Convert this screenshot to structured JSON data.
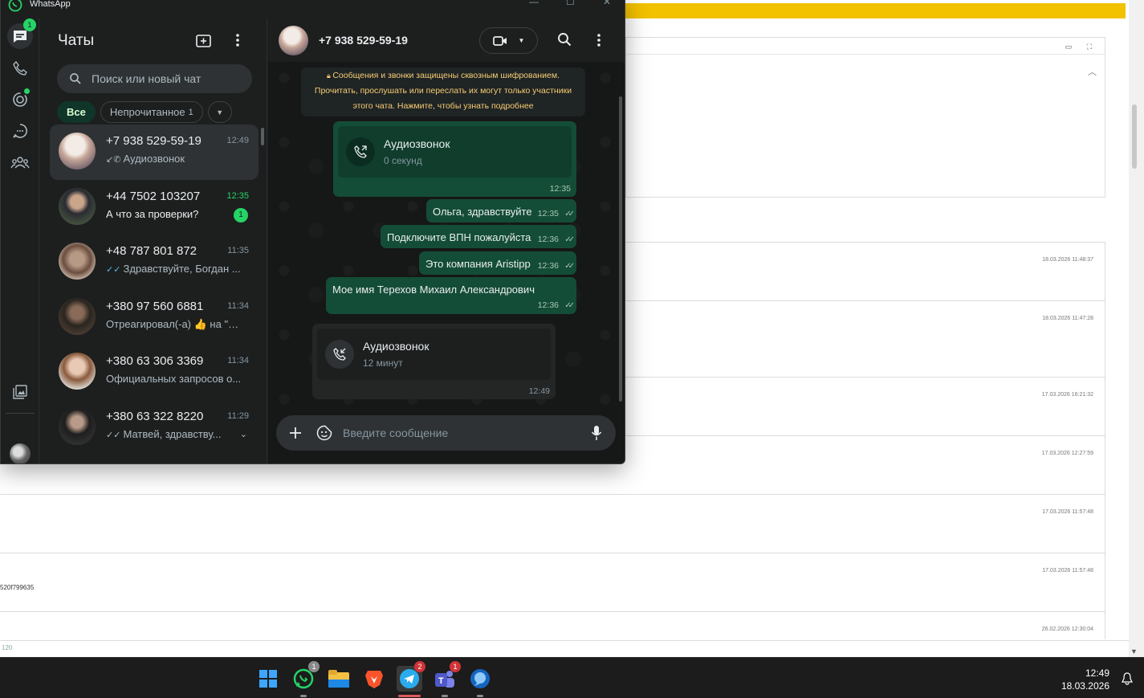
{
  "whatsapp": {
    "window_title": "WhatsApp",
    "rail": {
      "chats_badge": "1"
    },
    "chatlist": {
      "title": "Чаты",
      "search_placeholder": "Поиск или новый чат",
      "filters": [
        {
          "label": "Все",
          "active": true
        },
        {
          "label": "Непрочитанное",
          "count": "1"
        }
      ],
      "chats": [
        {
          "name": "+7 938 529-59-19",
          "time": "12:49",
          "preview": "Аудиозвонок",
          "icon": "incoming-call-icon",
          "active": true
        },
        {
          "name": "+44 7502 103207",
          "time": "12:35",
          "preview": "А что за проверки?",
          "unread": "1"
        },
        {
          "name": "+48 787 801 872",
          "time": "11:35",
          "preview": "Здравствуйте, Богдан ...",
          "icon": "double-check-icon"
        },
        {
          "name": "+380 97 560 6881",
          "time": "11:34",
          "preview": "Отреагировал(-а) 👍 на \"О..."
        },
        {
          "name": "+380 63 306 3369",
          "time": "11:34",
          "preview": "Официальных запросов о..."
        },
        {
          "name": "+380 63 322 8220",
          "time": "11:29",
          "preview": "Матвей, здравству...",
          "icon": "double-check-icon"
        }
      ]
    },
    "conversation": {
      "contact_name": "+7 938 529-59-19",
      "encryption_note": "Сообщения и звонки защищены сквозным шифрованием. Прочитать, прослушать или переслать их могут только участники этого чата. Нажмите, чтобы узнать подробнее",
      "call_out": {
        "title": "Аудиозвонок",
        "subtitle": "0 секунд",
        "time": "12:35"
      },
      "messages": [
        {
          "text": "Ольга, здравствуйте",
          "time": "12:35"
        },
        {
          "text": "Подключите ВПН пожалуйста",
          "time": "12:36"
        },
        {
          "text": "Это компания Aristipp",
          "time": "12:36"
        },
        {
          "text": "Мое имя Терехов Михаил Александрович",
          "time": "12:36"
        }
      ],
      "call_in": {
        "title": "Аудиозвонок",
        "subtitle": "12 минут",
        "time": "12:49"
      },
      "composer_placeholder": "Введите сообщение"
    }
  },
  "background_page": {
    "timestamps": [
      "18.03.2026 11:48:37",
      "18.03.2026 11:47:28",
      "17.03.2026 16:21:32",
      "17.03.2026 12:27:59",
      "17.03.2026 11:57:48",
      "17.03.2026 11:57:48",
      "26.02.2026 12:30:04"
    ],
    "fragment": "520f799635",
    "footer_text": "120"
  },
  "taskbar": {
    "whatsapp_badge": "1",
    "telegram_badge": "2",
    "teams_badge": "1",
    "time": "12:49",
    "date": "18.03.2026"
  },
  "colors": {
    "wa_green": "#25d366",
    "outgoing_bubble": "#144d37",
    "incoming_bubble": "#242626",
    "encryption_text": "#f7cd73",
    "page_highlight": "#f2c100"
  }
}
